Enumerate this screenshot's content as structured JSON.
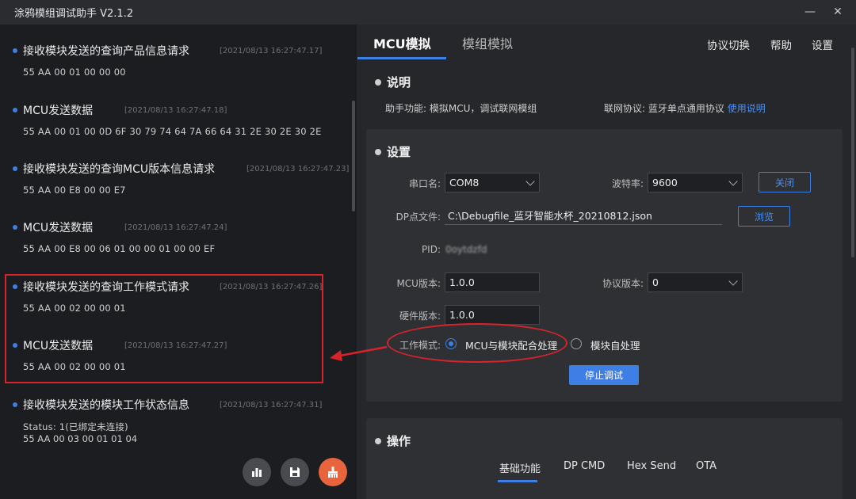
{
  "window": {
    "title": "涂鸦模组调试助手 V2.1.2",
    "min_glyph": "—",
    "close_glyph": "✕"
  },
  "log": [
    {
      "title": "接收模块发送的查询产品信息请求",
      "time": "[2021/08/13 16:27:47.17]",
      "data": "55 AA 00 01 00 00 00"
    },
    {
      "title": "MCU发送数据",
      "time": "[2021/08/13 16:27:47.18]",
      "data": "55 AA 00 01 00 0D 6F 30 79 74 64 7A 66 64 31 2E 30 2E 30 2E"
    },
    {
      "title": "接收模块发送的查询MCU版本信息请求",
      "time": "[2021/08/13 16:27:47.23]",
      "data": "55 AA 00 E8 00 00 E7"
    },
    {
      "title": "MCU发送数据",
      "time": "[2021/08/13 16:27:47.24]",
      "data": "55 AA 00 E8 00 06 01 00 00 01 00 00 EF"
    },
    {
      "title": "接收模块发送的查询工作模式请求",
      "time": "[2021/08/13 16:27:47.26]",
      "data": "55 AA 00 02 00 00 01"
    },
    {
      "title": "MCU发送数据",
      "time": "[2021/08/13 16:27:47.27]",
      "data": "55 AA 00 02 00 00 01"
    },
    {
      "title": "接收模块发送的模块工作状态信息",
      "time": "[2021/08/13 16:27:47.31]",
      "data": "Status: 1(已绑定未连接)",
      "data2": "55 AA 00 03 00 01 01 04"
    }
  ],
  "tabs": {
    "mcu": "MCU模拟",
    "module": "模组模拟"
  },
  "top_links": {
    "switch": "协议切换",
    "help": "帮助",
    "settings": "设置"
  },
  "desc": {
    "title": "说明",
    "func_label": "助手功能:",
    "func_value": "模拟MCU，调试联网模组",
    "proto_label": "联网协议:",
    "proto_value": "蓝牙单点通用协议",
    "manual_link": "使用说明"
  },
  "settings": {
    "title": "设置",
    "port_label": "串口名:",
    "port_value": "COM8",
    "baud_label": "波特率:",
    "baud_value": "9600",
    "close_btn": "关闭",
    "dp_label": "DP点文件:",
    "dp_value": "C:\\Debugfile_蓝牙智能水杯_20210812.json",
    "browse_btn": "浏览",
    "pid_label": "PID:",
    "pid_value": "0oytdzfd",
    "mcu_ver_label": "MCU版本:",
    "mcu_ver_value": "1.0.0",
    "proto_ver_label": "协议版本:",
    "proto_ver_value": "0",
    "hw_ver_label": "硬件版本:",
    "hw_ver_value": "1.0.0",
    "mode_label": "工作模式:",
    "mode_opt1": "MCU与模块配合处理",
    "mode_opt2": "模块自处理",
    "stop_btn": "停止调试"
  },
  "ops": {
    "title": "操作",
    "tabs": [
      "基础功能",
      "DP CMD",
      "Hex Send",
      "OTA"
    ]
  },
  "colors": {
    "accent": "#3d7fe5",
    "highlight": "#d8232a",
    "fab_clear": "#e8643c"
  },
  "icons": [
    "chart-icon",
    "save-icon",
    "broom-icon",
    "minimize-icon",
    "close-icon"
  ]
}
